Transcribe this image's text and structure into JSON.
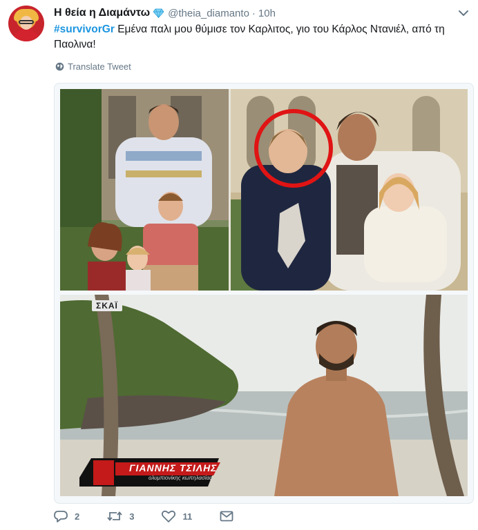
{
  "tweet": {
    "author": {
      "display_name": "Η θεία η Διαμάντω",
      "badge_icon": "gem-icon",
      "handle": "@theia_diamanto",
      "time": "10h"
    },
    "text": {
      "hashtag": "#survivorGr",
      "body": " Εμένα παλι μου θύμισε τον Καρλιτος, γιο του Κάρλος Ντανιέλ, από τη Παολινα!"
    },
    "translate_label": "Translate Tweet",
    "media": {
      "bottom_overlay": {
        "channel": "ΣΚΑΪ",
        "caption_name": "ΓΙΑΝΝΗΣ ΤΣΙΛΗΣ",
        "caption_sub": "ολυμπιονίκης κωπηλασίας"
      }
    },
    "actions": {
      "replies": "2",
      "retweets": "3",
      "likes": "11"
    }
  },
  "colors": {
    "hashtag": "#1b95e0",
    "secondary_text": "#657786",
    "highlight_circle": "#e01414"
  }
}
